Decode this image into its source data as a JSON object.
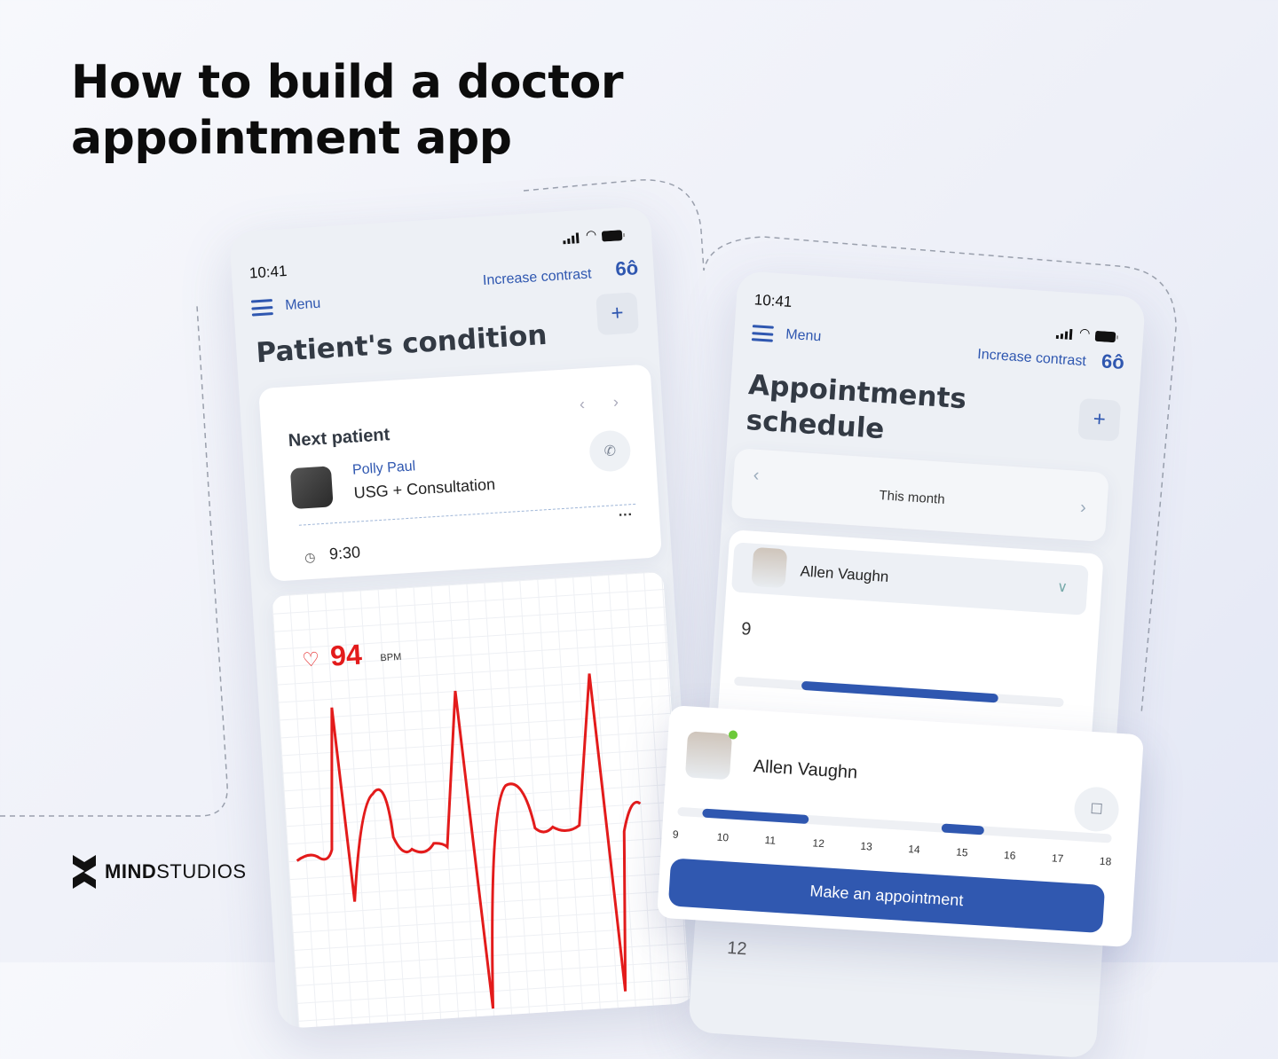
{
  "headline": {
    "line1": "How to build a doctor",
    "line2": "appointment app"
  },
  "brand": {
    "name_bold": "MIND",
    "name_rest": "STUDIOS"
  },
  "colors": {
    "accent": "#2f57b0",
    "heart": "#e31b1b",
    "online": "#6cc93a"
  },
  "patient_screen": {
    "time": "10:41",
    "menu": "Menu",
    "increase_contrast": "Increase contrast",
    "title": "Patient's condition",
    "next_patient": {
      "heading": "Next patient",
      "name": "Polly Paul",
      "service": "USG + Consultation",
      "time": "9:30"
    },
    "heart_rate": {
      "value": "94",
      "unit": "BPM"
    }
  },
  "schedule_screen": {
    "time": "10:41",
    "menu": "Menu",
    "increase_contrast": "Increase contrast",
    "title_line1": "Appointments",
    "title_line2": "schedule",
    "period": "This month",
    "doctor": "Allen Vaughn",
    "hour_start": "9",
    "hour_below": "12"
  },
  "doctor_popup": {
    "name": "Allen Vaughn",
    "online": true,
    "hours": [
      "9",
      "10",
      "11",
      "12",
      "13",
      "14",
      "15",
      "16",
      "17",
      "18"
    ],
    "busy_slots": [
      [
        10,
        12.2
      ],
      [
        15,
        15.9
      ]
    ],
    "cta": "Make an appointment"
  }
}
